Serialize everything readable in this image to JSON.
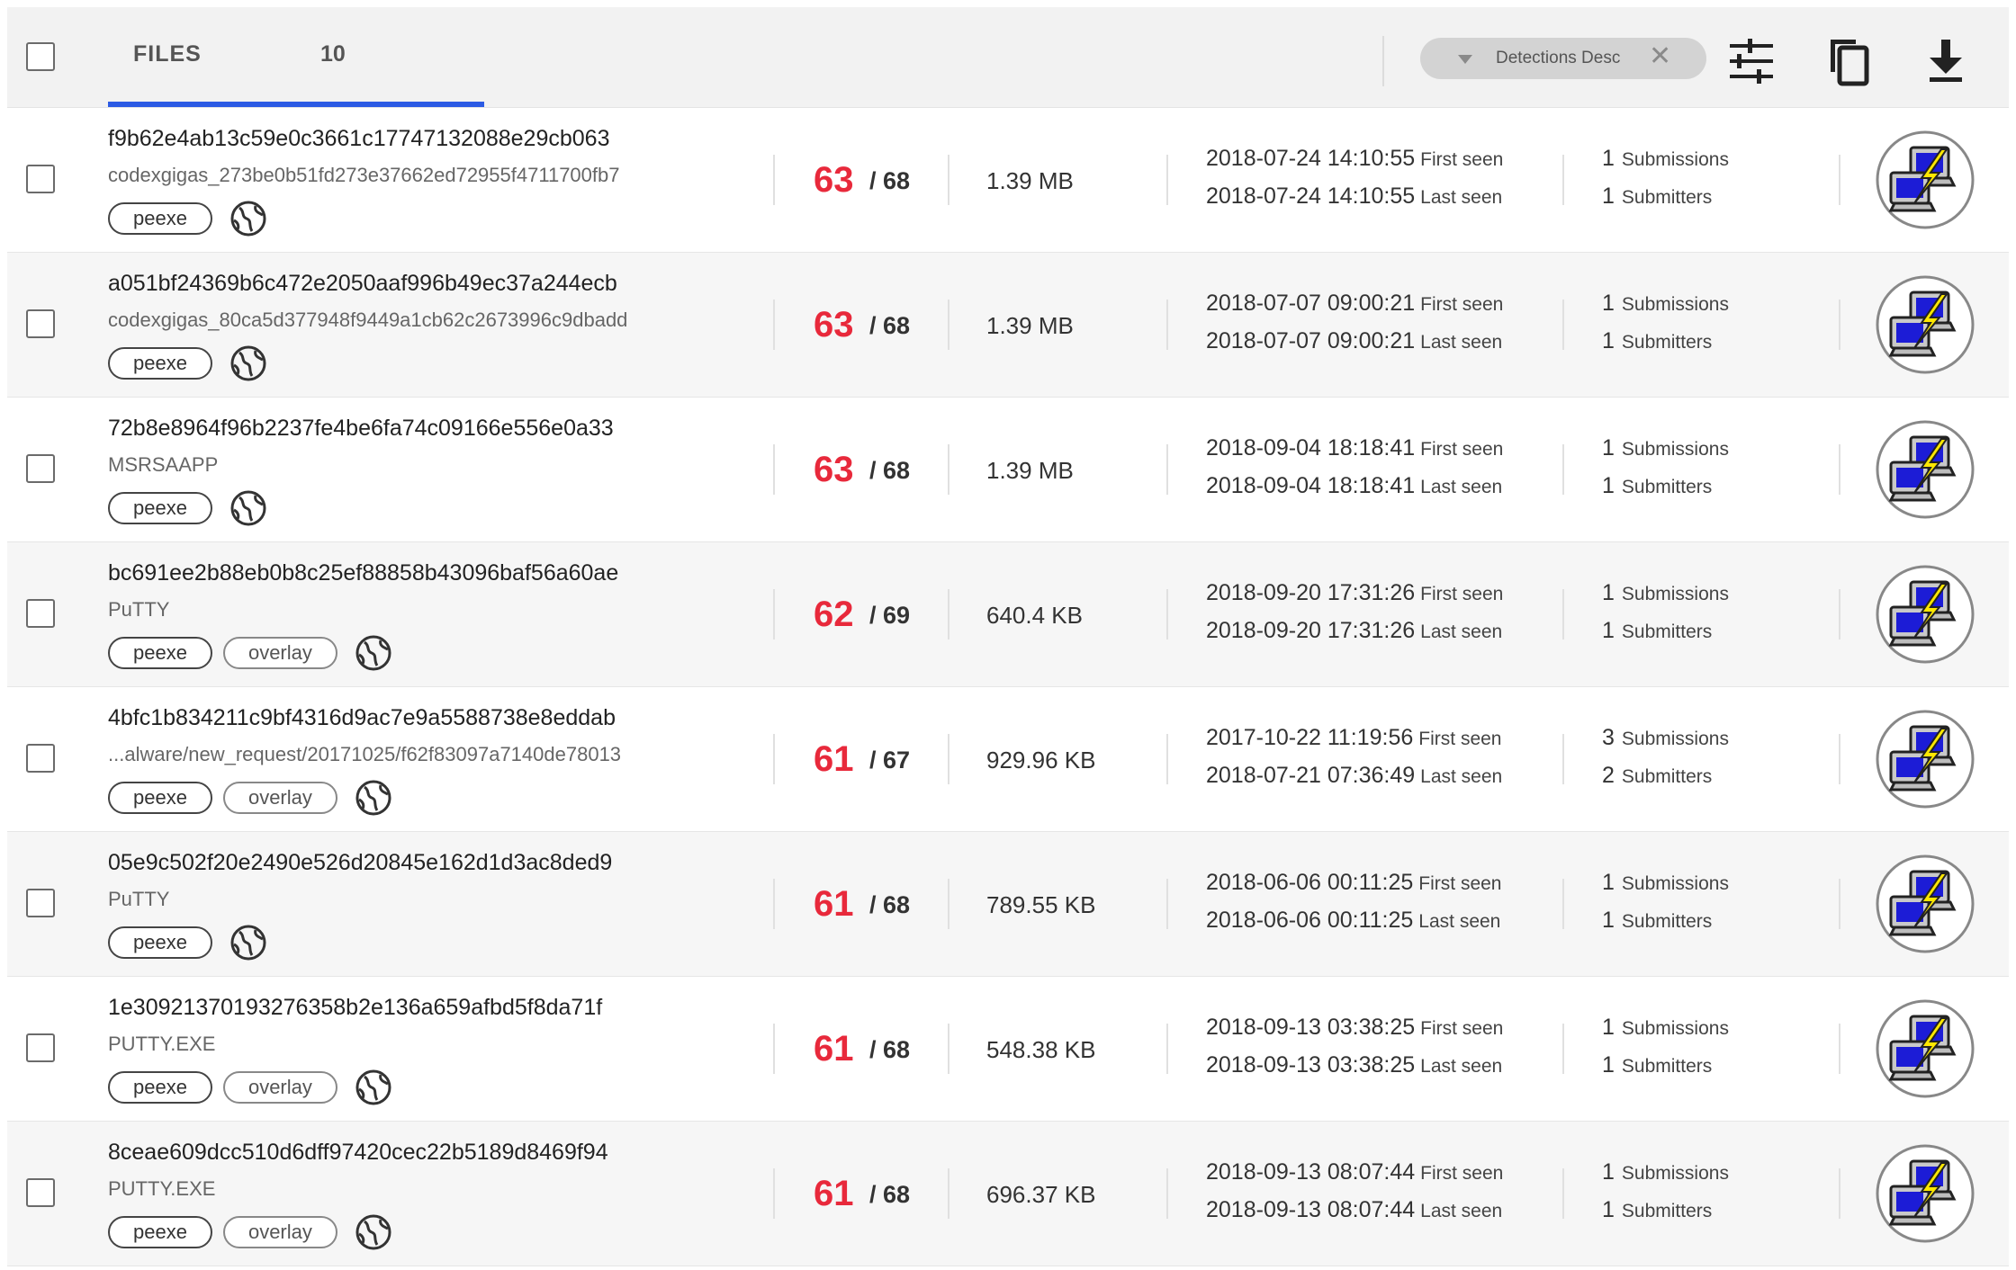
{
  "header": {
    "files_label": "FILES",
    "files_count": "10",
    "sort_label": "Detections Desc",
    "icons": [
      "filter-sliders-icon",
      "copy-icon",
      "download-icon"
    ]
  },
  "colors": {
    "accent": "#2c5be4",
    "detection": "#e8293b",
    "header_bg": "#f2f2f2"
  },
  "labels": {
    "first_seen": "First seen",
    "last_seen": "Last seen",
    "submissions": "Submissions",
    "submitters": "Submitters",
    "detection_sep": "/"
  },
  "rows": [
    {
      "hash": "f9b62e4ab13c59e0c3661c17747132088e29cb063",
      "name": "codexgigas_273be0b51fd273e37662ed72955f4711700fb7",
      "tags": [
        "peexe"
      ],
      "detections": "63",
      "engines": "68",
      "size": "1.39 MB",
      "first_seen": "2018-07-24 14:10:55",
      "last_seen": "2018-07-24 14:10:55",
      "submissions": "1",
      "submitters": "1"
    },
    {
      "hash": "a051bf24369b6c472e2050aaf996b49ec37a244ecb",
      "name": "codexgigas_80ca5d377948f9449a1cb62c2673996c9dbadd",
      "tags": [
        "peexe"
      ],
      "detections": "63",
      "engines": "68",
      "size": "1.39 MB",
      "first_seen": "2018-07-07 09:00:21",
      "last_seen": "2018-07-07 09:00:21",
      "submissions": "1",
      "submitters": "1"
    },
    {
      "hash": "72b8e8964f96b2237fe4be6fa74c09166e556e0a33",
      "name": "MSRSAAPP",
      "tags": [
        "peexe"
      ],
      "detections": "63",
      "engines": "68",
      "size": "1.39 MB",
      "first_seen": "2018-09-04 18:18:41",
      "last_seen": "2018-09-04 18:18:41",
      "submissions": "1",
      "submitters": "1"
    },
    {
      "hash": "bc691ee2b88eb0b8c25ef88858b43096baf56a60ae",
      "name": "PuTTY",
      "tags": [
        "peexe",
        "overlay"
      ],
      "detections": "62",
      "engines": "69",
      "size": "640.4 KB",
      "first_seen": "2018-09-20 17:31:26",
      "last_seen": "2018-09-20 17:31:26",
      "submissions": "1",
      "submitters": "1"
    },
    {
      "hash": "4bfc1b834211c9bf4316d9ac7e9a5588738e8eddab",
      "name": "...alware/new_request/20171025/f62f83097a7140de78013",
      "tags": [
        "peexe",
        "overlay"
      ],
      "detections": "61",
      "engines": "67",
      "size": "929.96 KB",
      "first_seen": "2017-10-22 11:19:56",
      "last_seen": "2018-07-21 07:36:49",
      "submissions": "3",
      "submitters": "2"
    },
    {
      "hash": "05e9c502f20e2490e526d20845e162d1d3ac8ded9",
      "name": "PuTTY",
      "tags": [
        "peexe"
      ],
      "detections": "61",
      "engines": "68",
      "size": "789.55 KB",
      "first_seen": "2018-06-06 00:11:25",
      "last_seen": "2018-06-06 00:11:25",
      "submissions": "1",
      "submitters": "1"
    },
    {
      "hash": "1e30921370193276358b2e136a659afbd5f8da71f",
      "name": "PUTTY.EXE",
      "tags": [
        "peexe",
        "overlay"
      ],
      "detections": "61",
      "engines": "68",
      "size": "548.38 KB",
      "first_seen": "2018-09-13 03:38:25",
      "last_seen": "2018-09-13 03:38:25",
      "submissions": "1",
      "submitters": "1"
    },
    {
      "hash": "8ceae609dcc510d6dff97420cec22b5189d8469f94",
      "name": "PUTTY.EXE",
      "tags": [
        "peexe",
        "overlay"
      ],
      "detections": "61",
      "engines": "68",
      "size": "696.37 KB",
      "first_seen": "2018-09-13 08:07:44",
      "last_seen": "2018-09-13 08:07:44",
      "submissions": "1",
      "submitters": "1"
    }
  ]
}
